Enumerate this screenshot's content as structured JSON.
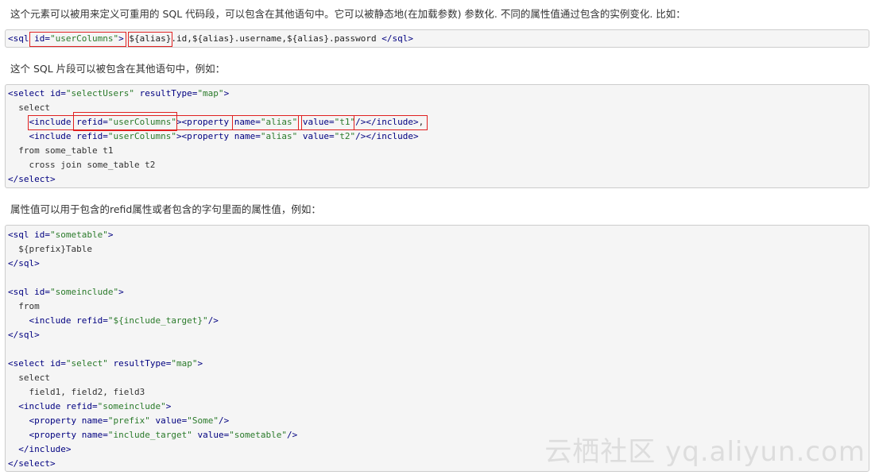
{
  "paragraphs": {
    "p1": "这个元素可以被用来定义可重用的 SQL 代码段，可以包含在其他语句中。它可以被静态地(在加载参数) 参数化. 不同的属性值通过包含的实例变化. 比如：",
    "p2": "这个 SQL 片段可以被包含在其他语句中，例如：",
    "p3": "属性值可以用于包含的refid属性或者包含的字句里面的属性值，例如："
  },
  "code1": {
    "line1": [
      "<sql",
      " id=",
      "\"userColumns\"",
      ">",
      " ",
      "${alias}",
      ".id,${alias}.username,${alias}.password ",
      "</sql>"
    ]
  },
  "code2": {
    "l1": [
      "<select",
      " id=",
      "\"selectUsers\"",
      " resultType=",
      "\"map\"",
      ">"
    ],
    "l2": "  select",
    "l3": [
      "    ",
      "<include",
      " refid=",
      "\"userColumns\"",
      "><property",
      " name=",
      "\"alias\"",
      " value=",
      "\"t1\"",
      "/></include>",
      ","
    ],
    "l4": [
      "    ",
      "<include",
      " refid=",
      "\"userColumns\"",
      "><property",
      " name=",
      "\"alias\"",
      " value=",
      "\"t2\"",
      "/></include>"
    ],
    "l5": "  from some_table t1",
    "l6": "    cross join some_table t2",
    "l7": "</select>"
  },
  "code3": {
    "l1": [
      "<sql",
      " id=",
      "\"sometable\"",
      ">"
    ],
    "l2": "  ${prefix}Table",
    "l3": "</sql>",
    "l4": [
      "<sql",
      " id=",
      "\"someinclude\"",
      ">"
    ],
    "l5": "  from",
    "l6": [
      "    ",
      "<include",
      " refid=",
      "\"${include_target}\"",
      "/>"
    ],
    "l7": "</sql>",
    "l8": [
      "<select",
      " id=",
      "\"select\"",
      " resultType=",
      "\"map\"",
      ">"
    ],
    "l9": "  select",
    "l10": "    field1, field2, field3",
    "l11": [
      "  ",
      "<include",
      " refid=",
      "\"someinclude\"",
      ">"
    ],
    "l12": [
      "    ",
      "<property",
      " name=",
      "\"prefix\"",
      " value=",
      "\"Some\"",
      "/>"
    ],
    "l13": [
      "    ",
      "<property",
      " name=",
      "\"include_target\"",
      " value=",
      "\"sometable\"",
      "/>"
    ],
    "l14": [
      "  ",
      "</include>"
    ],
    "l15": "</select>"
  },
  "watermark": "云栖社区 yq.aliyun.com",
  "colors": {
    "tag": "#000080",
    "string": "#2a7a2a",
    "highlight": "#e02020",
    "code_bg": "#f5f5f5"
  }
}
